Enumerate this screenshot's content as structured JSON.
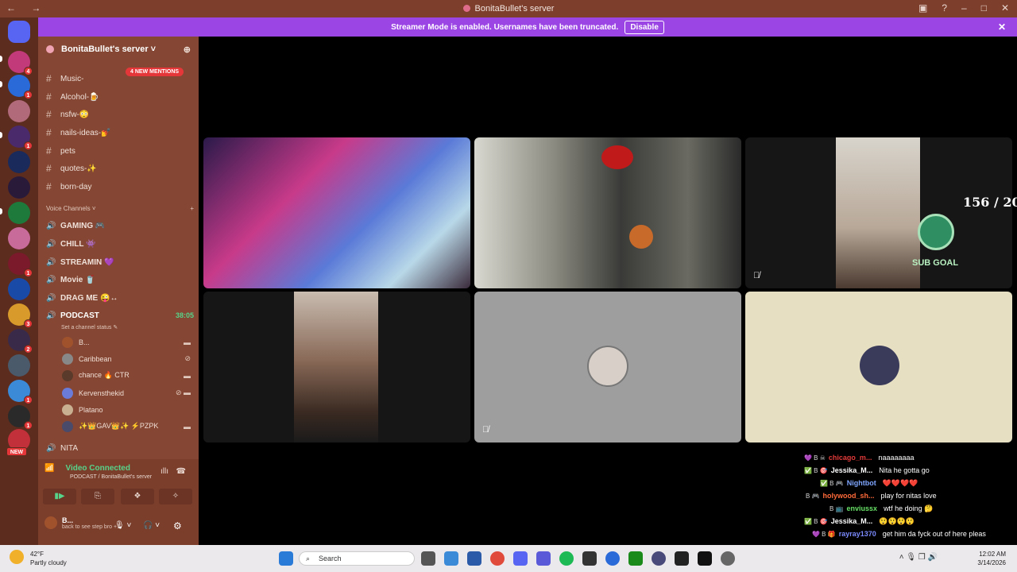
{
  "window": {
    "title": "BonitaBullet's server",
    "nav": "← →",
    "controls": [
      "▣",
      "?",
      "–",
      "□",
      "✕"
    ]
  },
  "banner": {
    "text": "Streamer Mode is enabled. Usernames have been truncated.",
    "button": "Disable"
  },
  "server": {
    "name": "BonitaBullet's server ˅"
  },
  "mentions_badge": "4 NEW MENTIONS",
  "text_channels": [
    {
      "name": "Music-"
    },
    {
      "name": "Alcohol-🍺"
    },
    {
      "name": "nsfw-😳"
    },
    {
      "name": "nails-ideas-💅"
    },
    {
      "name": "pets"
    },
    {
      "name": "quotes-✨"
    },
    {
      "name": "born-day"
    }
  ],
  "voice_category": {
    "label": "Voice Channels ˅",
    "add": "+"
  },
  "voice_channels": [
    {
      "name": "GAMING 🎮"
    },
    {
      "name": "CHILL 👾"
    },
    {
      "name": "STREAMIN 💜"
    },
    {
      "name": "Movie 🥤"
    },
    {
      "name": "DRAG ME 😜↔"
    }
  ],
  "podcast": {
    "name": "PODCAST",
    "timer": "38:05",
    "status": "Set a channel status ✎"
  },
  "podcast_users": [
    {
      "name": "B...",
      "color": "#a0522d"
    },
    {
      "name": "Caribbean",
      "color": "#888888"
    },
    {
      "name": "chance 🔥 CTR",
      "color": "#5a3a2a"
    },
    {
      "name": "Kervensthekid",
      "color": "#6a7bd8"
    },
    {
      "name": "Platano",
      "color": "#c8b090"
    },
    {
      "name": "✨👑GAV👑✨ ⚡PZPK",
      "color": "#4a4a6a"
    }
  ],
  "nita_channel": "NITA",
  "voice_panel": {
    "status": "Video Connected",
    "sub": "PODCAST / BonitaBullet's server",
    "buttons": [
      "▮▶",
      "⎘",
      "❖",
      "✧"
    ],
    "user": "B...",
    "user_status": "back to see step bro +1"
  },
  "goal": {
    "count": "156 / 20",
    "label": "SUB GOAL"
  },
  "chat": [
    {
      "badges": "💜 B ☠",
      "user": "chicago_m...",
      "msg": "naaaaaaaa",
      "color": "#e33a3a"
    },
    {
      "badges": "✅ B 🎯",
      "user": "Jessika_M...",
      "msg": "Nita he gotta go",
      "color": "#ffffff"
    },
    {
      "badges": "✅ B 🎮",
      "user": "Nightbot",
      "msg": "❤️❤️❤️❤️",
      "color": "#7fa6ff"
    },
    {
      "badges": "B 🎮",
      "user": "holywood_sh...",
      "msg": "play for nitas love",
      "color": "#ff6a3a"
    },
    {
      "badges": "B 📺",
      "user": "enviussx",
      "msg": "wtf he doing 🤔",
      "color": "#67e067"
    },
    {
      "badges": "✅ B 🎯",
      "user": "Jessika_M...",
      "msg": "😲😲😲😲",
      "color": "#ffffff"
    },
    {
      "badges": "💜 B 🎁",
      "user": "rayray1370",
      "msg": "get him da fyck out of here pleas",
      "color": "#7b8bff"
    }
  ],
  "taskbar": {
    "weather_temp": "42°F",
    "weather_desc": "Partly cloudy",
    "search": "Search",
    "time": "12:02 AM",
    "date": "3/14/2026",
    "tray": "˄  🎙  ❐  🔊"
  },
  "colors": {
    "sidebar": "#854733",
    "guilds": "#5c2c1e",
    "banner": "#9b45e5",
    "titlebar": "#7d3f2c",
    "connected": "#57d38a"
  }
}
